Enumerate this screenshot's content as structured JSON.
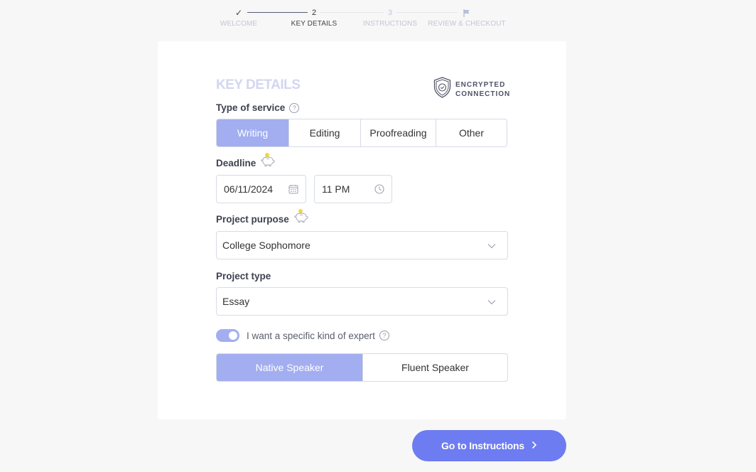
{
  "stepper": {
    "steps": [
      {
        "marker": "✓",
        "label": "WELCOME",
        "state": "done"
      },
      {
        "marker": "2",
        "label": "KEY DETAILS",
        "state": "active"
      },
      {
        "marker": "3",
        "label": "INSTRUCTIONS",
        "state": "upcoming"
      },
      {
        "marker": "flag",
        "label": "REVIEW & CHECKOUT",
        "state": "upcoming"
      }
    ]
  },
  "card": {
    "title": "KEY DETAILS",
    "encrypted": {
      "line1": "ENCRYPTED",
      "line2": "CONNECTION",
      "icon": "shield-check-icon"
    }
  },
  "service": {
    "label": "Type of service",
    "help_icon": "?",
    "options": [
      "Writing",
      "Editing",
      "Proofreading",
      "Other"
    ],
    "selected": "Writing"
  },
  "deadline": {
    "label": "Deadline",
    "date": "06/11/2024",
    "time": "11 PM"
  },
  "purpose": {
    "label": "Project purpose",
    "value": "College Sophomore"
  },
  "project_type": {
    "label": "Project type",
    "value": "Essay"
  },
  "expert": {
    "toggle_label": "I want a specific kind of expert",
    "toggle_on": true,
    "help_icon": "?",
    "options": [
      "Native Speaker",
      "Fluent Speaker"
    ],
    "selected": "Native Speaker"
  },
  "cta": {
    "label": "Go to Instructions",
    "icon": "chevron-right-icon"
  },
  "colors": {
    "accent": "#6d7cf0",
    "selected": "#a2aef0",
    "title": "#d3d6ef"
  }
}
